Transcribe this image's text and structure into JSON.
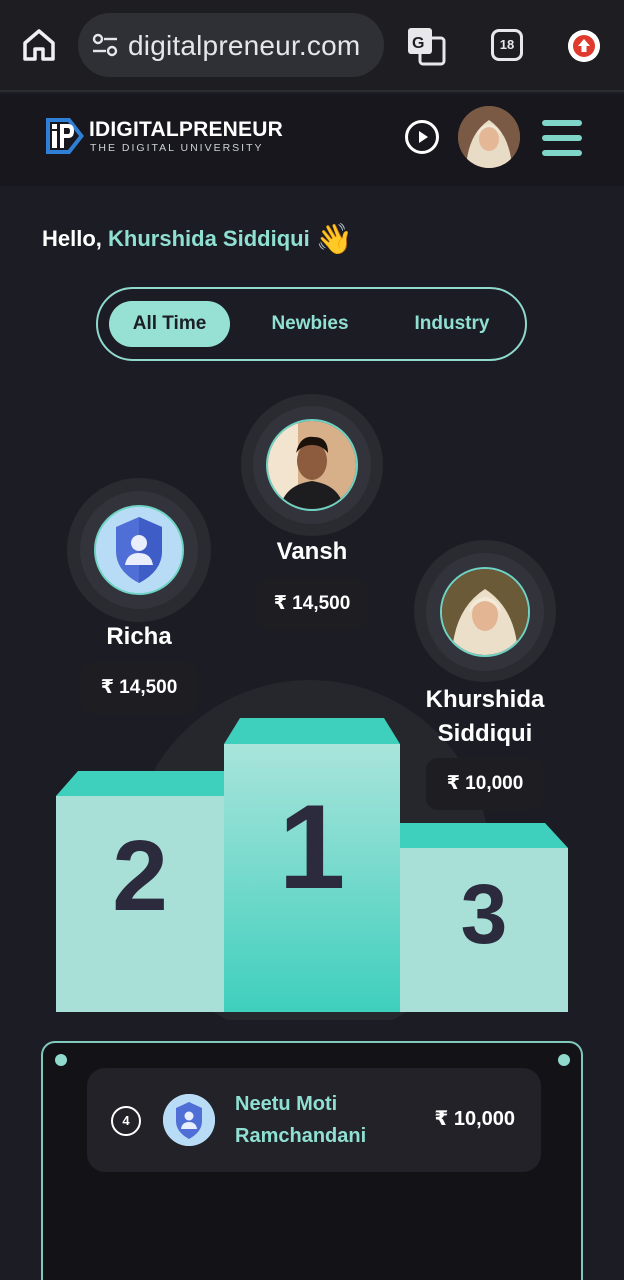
{
  "browser": {
    "url": "digitalpreneur.com",
    "tab_count": "18"
  },
  "header": {
    "logo_title": "IDIGITALPRENEUR",
    "logo_subtitle": "THE DIGITAL UNIVERSITY"
  },
  "greeting": {
    "hello": "Hello, ",
    "name": "Khurshida Siddiqui",
    "emoji": "👋"
  },
  "tabs": [
    {
      "label": "All Time",
      "active": true
    },
    {
      "label": "Newbies",
      "active": false
    },
    {
      "label": "Industry",
      "active": false
    }
  ],
  "podium": {
    "first": {
      "name": "Vansh",
      "amount": "₹ 14,500",
      "rank": "1"
    },
    "second": {
      "name": "Richa",
      "amount": "₹ 14,500",
      "rank": "2"
    },
    "third": {
      "name_line1": "Khurshida",
      "name_line2": "Siddiqui",
      "amount": "₹ 10,000",
      "rank": "3"
    }
  },
  "list": [
    {
      "rank": "4",
      "name": "Neetu Moti Ramchandani",
      "amount": "₹ 10,000"
    }
  ],
  "colors": {
    "accent": "#8fe0d2",
    "podium_top": "#3fcfbd",
    "podium_face": "#a8e0d8",
    "background": "#1c1c24"
  }
}
